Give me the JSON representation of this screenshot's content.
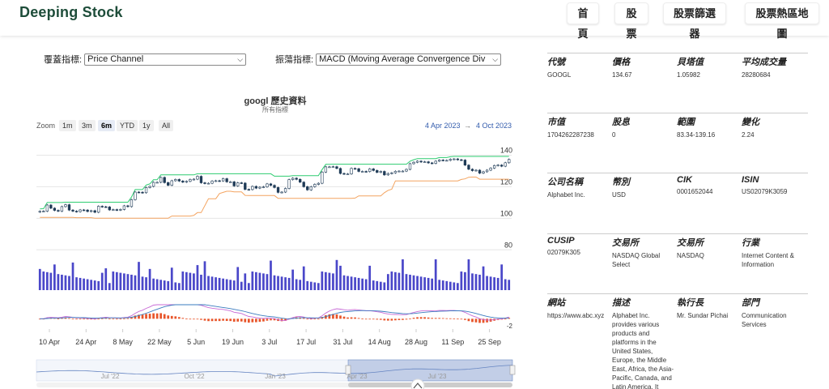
{
  "header": {
    "brand": "Deeping Stock",
    "nav": [
      "首頁",
      "股票",
      "股票篩選器",
      "股票熱區地圖"
    ]
  },
  "controls": {
    "overlay_label": "覆蓋指標:",
    "overlay_value": "Price Channel",
    "oscillator_label": "振蕩指標:",
    "oscillator_value": "MACD (Moving Average Convergence Div"
  },
  "chart": {
    "title": "googl 歷史資料",
    "subtitle": "所有指標",
    "zoom_label": "Zoom",
    "zoom_buttons": [
      "1m",
      "3m",
      "6m",
      "YTD",
      "1y",
      "All"
    ],
    "zoom_active": "6m",
    "date_from": "4 Apr 2023",
    "date_arrow": "→",
    "date_to": "4 Oct 2023",
    "x_ticks": [
      "10 Apr",
      "24 Apr",
      "8 May",
      "22 May",
      "5 Jun",
      "19 Jun",
      "3 Jul",
      "17 Jul",
      "31 Jul",
      "14 Aug",
      "28 Aug",
      "11 Sep",
      "25 Sep"
    ],
    "navigator_ticks": [
      "Jul '22",
      "Oct '22",
      "Jan '23",
      "Apr '23",
      "Jul '23"
    ],
    "colors": {
      "candle_up": "#ffffff",
      "candle_down": "#1f3b57",
      "channel_upper": "#2ecc71",
      "channel_lower": "#f4a460",
      "volume": "#4a47c9",
      "macd_line": "#c86bd6",
      "signal_line": "#3a7bbf",
      "histogram": "#e8552a"
    }
  },
  "chart_data": {
    "type": "candlestick",
    "x": [
      "2023-04-04",
      "2023-04-05",
      "2023-04-06",
      "2023-04-10",
      "2023-04-11",
      "2023-04-12",
      "2023-04-13",
      "2023-04-14",
      "2023-04-17",
      "2023-04-18",
      "2023-04-19",
      "2023-04-20",
      "2023-04-21",
      "2023-04-24",
      "2023-04-25",
      "2023-04-26",
      "2023-04-27",
      "2023-04-28",
      "2023-05-01",
      "2023-05-02",
      "2023-05-03",
      "2023-05-04",
      "2023-05-05",
      "2023-05-08",
      "2023-05-09",
      "2023-05-10",
      "2023-05-11",
      "2023-05-12",
      "2023-05-15",
      "2023-05-16",
      "2023-05-17",
      "2023-05-18",
      "2023-05-19",
      "2023-05-22",
      "2023-05-23",
      "2023-05-24",
      "2023-05-25",
      "2023-05-26",
      "2023-05-30",
      "2023-05-31",
      "2023-06-01",
      "2023-06-02",
      "2023-06-05",
      "2023-06-06",
      "2023-06-07",
      "2023-06-08",
      "2023-06-09",
      "2023-06-12",
      "2023-06-13",
      "2023-06-14",
      "2023-06-15",
      "2023-06-16",
      "2023-06-20",
      "2023-06-21",
      "2023-06-22",
      "2023-06-23",
      "2023-06-26",
      "2023-06-27",
      "2023-06-28",
      "2023-06-29",
      "2023-06-30",
      "2023-07-03",
      "2023-07-05",
      "2023-07-06",
      "2023-07-07",
      "2023-07-10",
      "2023-07-11",
      "2023-07-12",
      "2023-07-13",
      "2023-07-14",
      "2023-07-17",
      "2023-07-18",
      "2023-07-19",
      "2023-07-20",
      "2023-07-21",
      "2023-07-24",
      "2023-07-25",
      "2023-07-26",
      "2023-07-27",
      "2023-07-28",
      "2023-07-31",
      "2023-08-01",
      "2023-08-02",
      "2023-08-03",
      "2023-08-04",
      "2023-08-07",
      "2023-08-08",
      "2023-08-09",
      "2023-08-10",
      "2023-08-11",
      "2023-08-14",
      "2023-08-15",
      "2023-08-16",
      "2023-08-17",
      "2023-08-18",
      "2023-08-21",
      "2023-08-22",
      "2023-08-23",
      "2023-08-24",
      "2023-08-25",
      "2023-08-28",
      "2023-08-29",
      "2023-08-30",
      "2023-08-31",
      "2023-09-01",
      "2023-09-05",
      "2023-09-06",
      "2023-09-07",
      "2023-09-08",
      "2023-09-11",
      "2023-09-12",
      "2023-09-13",
      "2023-09-14",
      "2023-09-15",
      "2023-09-18",
      "2023-09-19",
      "2023-09-20",
      "2023-09-21",
      "2023-09-22",
      "2023-09-25",
      "2023-09-26",
      "2023-09-27",
      "2023-09-28",
      "2023-09-29",
      "2023-10-02",
      "2023-10-03",
      "2023-10-04"
    ],
    "close": [
      104.4,
      104.5,
      108.4,
      106.4,
      105.0,
      104.5,
      107.4,
      108.6,
      105.2,
      104.5,
      104.2,
      105.3,
      105.2,
      104.3,
      104.8,
      103.8,
      107.6,
      107.3,
      107.2,
      105.3,
      105.5,
      105.2,
      105.6,
      107.9,
      107.4,
      111.8,
      116.6,
      116.5,
      116.2,
      119.5,
      120.2,
      122.8,
      122.8,
      125.9,
      122.6,
      120.9,
      123.8,
      124.6,
      123.6,
      122.9,
      123.4,
      124.6,
      124.8,
      126.6,
      122.5,
      122.1,
      122.2,
      123.6,
      123.8,
      123.7,
      125.1,
      123.1,
      123.1,
      120.5,
      122.5,
      122.3,
      118.3,
      118.2,
      120.2,
      119.1,
      119.7,
      119.9,
      121.8,
      120.9,
      119.5,
      116.4,
      116.6,
      118.9,
      124.5,
      125.4,
      124.7,
      122.9,
      120.0,
      118.0,
      120.0,
      121.5,
      122.2,
      129.3,
      132.6,
      132.6,
      132.7,
      131.6,
      128.4,
      128.1,
      128.1,
      131.6,
      131.4,
      129.7,
      129.7,
      129.6,
      131.3,
      130.3,
      129.1,
      129.7,
      127.5,
      128.4,
      128.8,
      129.8,
      129.9,
      129.9,
      131.0,
      134.6,
      135.5,
      136.2,
      135.7,
      135.8,
      135.1,
      134.8,
      136.2,
      136.9,
      136.7,
      136.7,
      137.4,
      137.6,
      137.1,
      136.9,
      133.7,
      131.1,
      130.2,
      130.5,
      128.6,
      129.5,
      130.5,
      131.8,
      133.4,
      133.7,
      133.0,
      135.2,
      137.3
    ],
    "volume_range": [
      16000000,
      59000000
    ],
    "macd_range": [
      -2,
      4
    ],
    "ylim": [
      75,
      150
    ],
    "y_ticks": [
      80,
      100,
      120,
      140
    ]
  },
  "info": {
    "blocks": [
      [
        {
          "h": "代號",
          "v": "GOOGL"
        },
        {
          "h": "價格",
          "v": "134.67"
        },
        {
          "h": "貝塔值",
          "v": "1.05982"
        },
        {
          "h": "平均成交量",
          "v": "28280684"
        }
      ],
      [
        {
          "h": "市值",
          "v": "1704262287238"
        },
        {
          "h": "股息",
          "v": "0"
        },
        {
          "h": "範圍",
          "v": "83.34-139.16"
        },
        {
          "h": "變化",
          "v": "2.24"
        }
      ],
      [
        {
          "h": "公司名稱",
          "v": "Alphabet Inc."
        },
        {
          "h": "幣別",
          "v": "USD"
        },
        {
          "h": "CIK",
          "v": "0001652044"
        },
        {
          "h": "ISIN",
          "v": "US02079K3059"
        }
      ],
      [
        {
          "h": "CUSIP",
          "v": "02079K305"
        },
        {
          "h": "交易所",
          "v": "NASDAQ Global Select"
        },
        {
          "h": "交易所",
          "v": "NASDAQ"
        },
        {
          "h": "行業",
          "v": "Internet Content & Information"
        }
      ],
      [
        {
          "h": "網站",
          "v": "https://www.abc.xyz"
        },
        {
          "h": "描述",
          "v": "Alphabet Inc. provides various products and platforms in the United States, Europe, the Middle East, Africa, the Asia-Pacific, Canada, and Latin America. It"
        },
        {
          "h": "執行長",
          "v": "Mr. Sundar Pichai"
        },
        {
          "h": "部門",
          "v": "Communication Services"
        }
      ]
    ]
  }
}
